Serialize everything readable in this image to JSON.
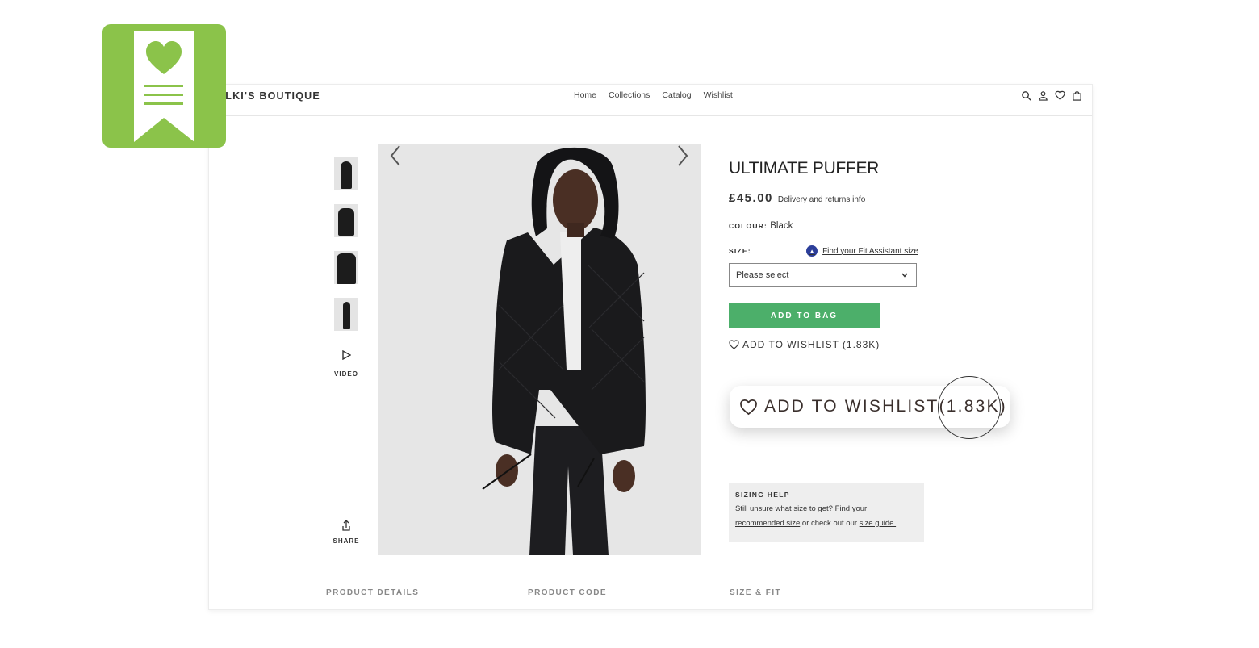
{
  "header": {
    "brand": "ALKI'S BOUTIQUE",
    "nav": [
      "Home",
      "Collections",
      "Catalog",
      "Wishlist"
    ],
    "icons": [
      "search-icon",
      "account-icon",
      "wishlist-heart-icon",
      "bag-icon"
    ]
  },
  "gallery": {
    "thumbnails": [
      "thumbnail-1",
      "thumbnail-2",
      "thumbnail-3",
      "thumbnail-4"
    ],
    "video_label": "VIDEO",
    "share_label": "SHARE"
  },
  "product": {
    "title": "ULTIMATE PUFFER",
    "price": "£45.00",
    "delivery_link": "Delivery and returns info",
    "colour_label": "COLOUR:",
    "colour_value": "Black",
    "size_label": "SIZE:",
    "fit_assistant": "Find your Fit Assistant size",
    "size_select": "Please select",
    "add_to_bag": "ADD TO BAG",
    "wishlist_label": "ADD TO WISHLIST",
    "wishlist_count": "(1.83K)"
  },
  "callout": {
    "label": "ADD TO WISHLIST",
    "count": "(1.83K)"
  },
  "sizing_help": {
    "heading": "SIZING HELP",
    "text_1": "Still unsure what size to get?",
    "link_1": "Find your recommended size",
    "text_2": "or check out our",
    "link_2": "size guide."
  },
  "bottom_tabs": [
    "PRODUCT DETAILS",
    "PRODUCT CODE",
    "SIZE & FIT"
  ],
  "colors": {
    "logo_green": "#8bc34a",
    "add_to_bag_green": "#4caf6a"
  }
}
